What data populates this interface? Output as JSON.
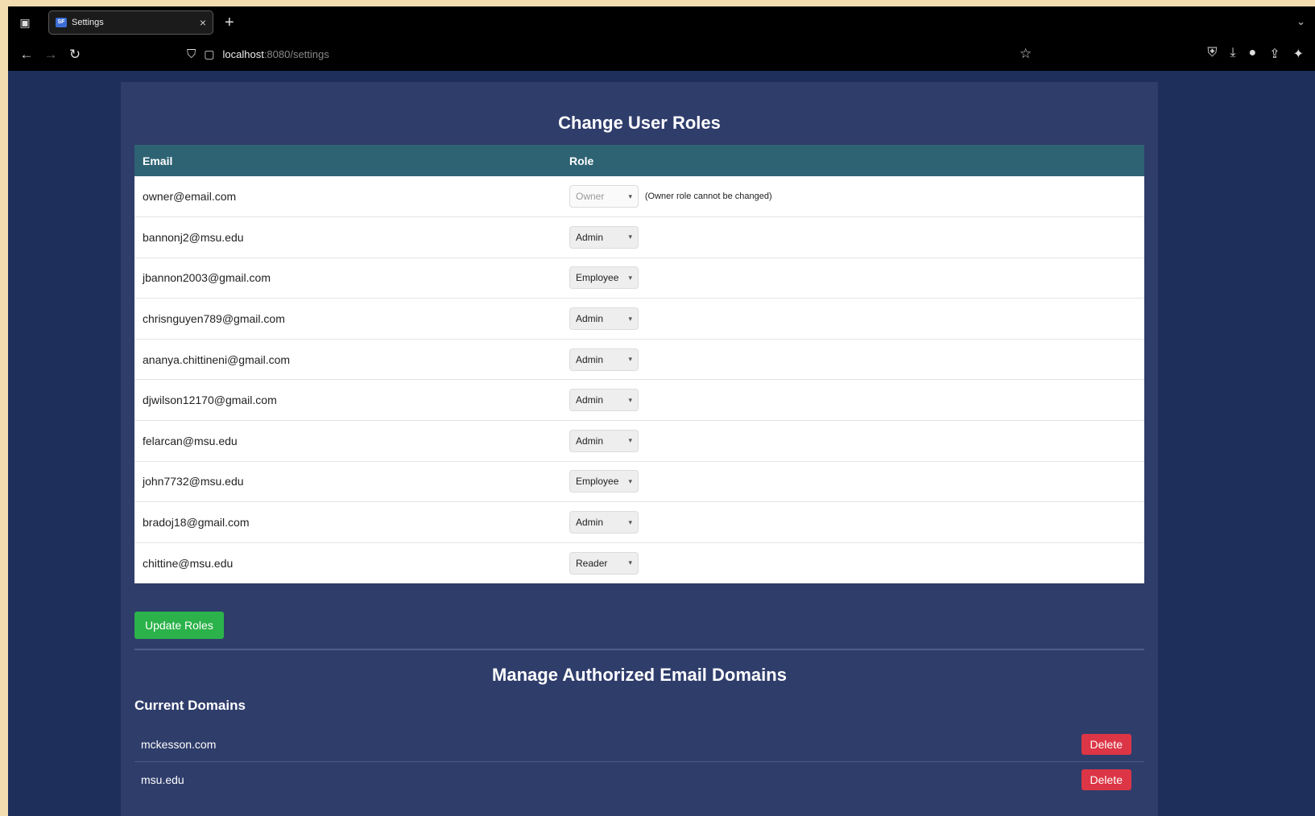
{
  "browser": {
    "tab_title": "Settings",
    "favicon_text": "SF",
    "url_host": "localhost",
    "url_rest": ":8080/settings"
  },
  "roles_section": {
    "title": "Change User Roles",
    "columns": [
      "Email",
      "Role"
    ],
    "owner_note": "(Owner role cannot be changed)",
    "rows": [
      {
        "email": "owner@email.com",
        "role": "Owner"
      },
      {
        "email": "bannonj2@msu.edu",
        "role": "Admin"
      },
      {
        "email": "jbannon2003@gmail.com",
        "role": "Employee"
      },
      {
        "email": "chrisnguyen789@gmail.com",
        "role": "Admin"
      },
      {
        "email": "ananya.chittineni@gmail.com",
        "role": "Admin"
      },
      {
        "email": "djwilson12170@gmail.com",
        "role": "Admin"
      },
      {
        "email": "felarcan@msu.edu",
        "role": "Admin"
      },
      {
        "email": "john7732@msu.edu",
        "role": "Employee"
      },
      {
        "email": "bradoj18@gmail.com",
        "role": "Admin"
      },
      {
        "email": "chittine@msu.edu",
        "role": "Reader"
      }
    ],
    "update_label": "Update Roles"
  },
  "domains_section": {
    "title": "Manage Authorized Email Domains",
    "subtitle": "Current Domains",
    "domains": [
      {
        "name": "mckesson.com",
        "action": "Delete"
      },
      {
        "name": "msu.edu",
        "action": "Delete"
      }
    ]
  },
  "colors": {
    "page_bg": "#1e2f5c",
    "card_bg": "#2f3d6b",
    "table_header": "#2e6374",
    "update_button": "#2bb24a",
    "delete_button": "#dc3545"
  }
}
